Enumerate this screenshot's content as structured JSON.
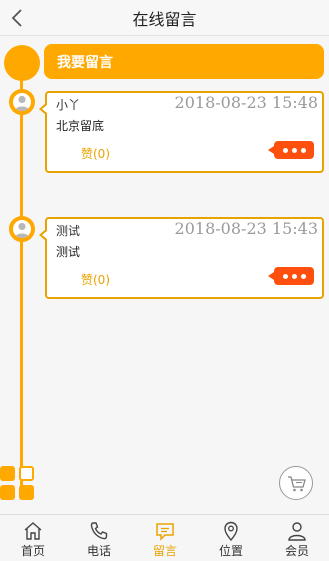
{
  "header": {
    "title": "在线留言"
  },
  "banner": {
    "label": "我要留言"
  },
  "messages": [
    {
      "name": "小丫",
      "time": "2018-08-23 15:48",
      "content": "北京留底",
      "like": "赞(0)"
    },
    {
      "name": "测试",
      "time": "2018-08-23 15:43",
      "content": "测试",
      "like": "赞(0)"
    }
  ],
  "tabs": [
    {
      "label": "首页",
      "icon": "home-icon"
    },
    {
      "label": "电话",
      "icon": "phone-icon"
    },
    {
      "label": "留言",
      "icon": "message-icon",
      "active": true
    },
    {
      "label": "位置",
      "icon": "location-icon"
    },
    {
      "label": "会员",
      "icon": "user-icon"
    }
  ],
  "colors": {
    "accent": "#ffa800",
    "more_button": "#ff4f0e",
    "active_tab": "#e8a300"
  }
}
